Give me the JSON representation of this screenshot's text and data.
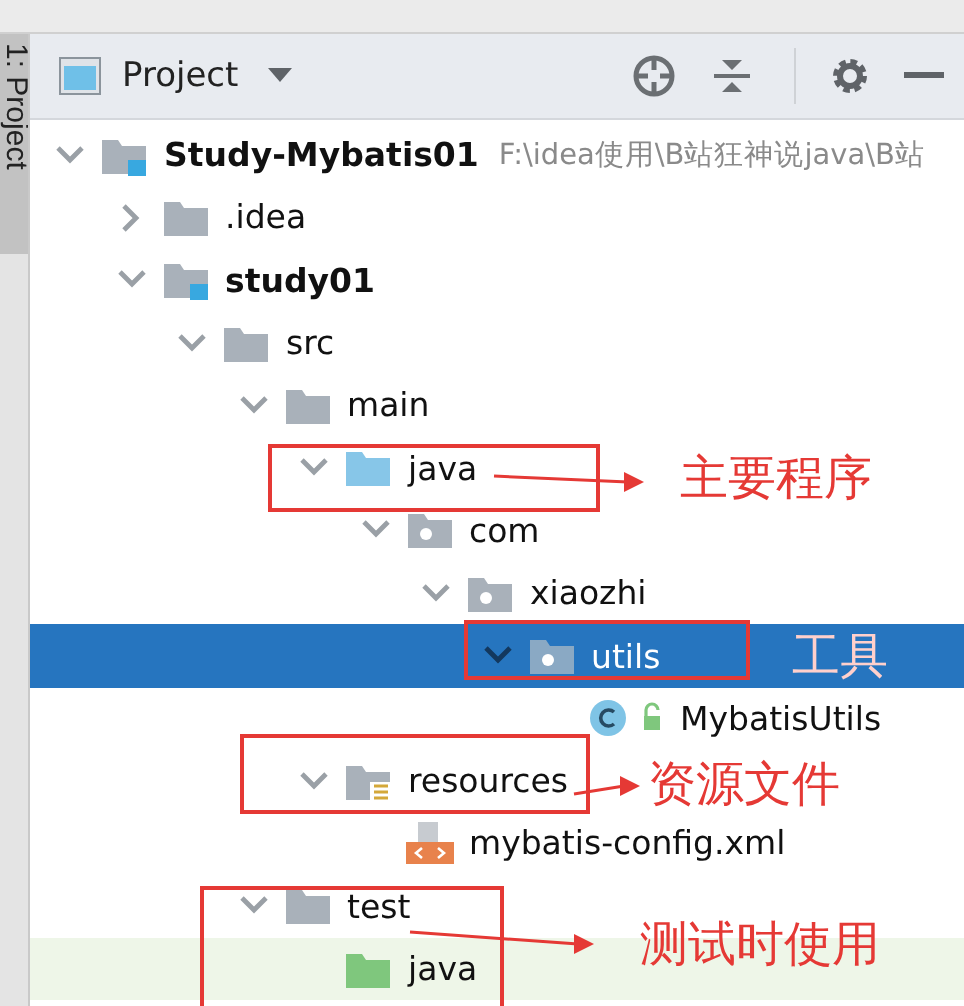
{
  "side_tab": {
    "label": "1: Project"
  },
  "panel": {
    "title": "Project"
  },
  "tree": [
    {
      "name": "Study-Mybatis01",
      "kind": "module",
      "path": "F:\\idea使用\\B站狂神说java\\B站",
      "expanded": true,
      "selected": false,
      "highlighted": false,
      "children": [
        {
          "name": ".idea",
          "kind": "folder",
          "expanded": false,
          "selected": false,
          "highlighted": false
        },
        {
          "name": "study01",
          "kind": "module",
          "expanded": true,
          "selected": false,
          "highlighted": false,
          "children": [
            {
              "name": "src",
              "kind": "folder",
              "expanded": true,
              "selected": false,
              "highlighted": false,
              "children": [
                {
                  "name": "main",
                  "kind": "folder",
                  "expanded": true,
                  "selected": false,
                  "highlighted": false,
                  "children": [
                    {
                      "name": "java",
                      "kind": "source",
                      "expanded": true,
                      "selected": false,
                      "highlighted": false,
                      "children": [
                        {
                          "name": "com",
                          "kind": "package",
                          "expanded": true,
                          "selected": false,
                          "highlighted": false,
                          "children": [
                            {
                              "name": "xiaozhi",
                              "kind": "package",
                              "expanded": true,
                              "selected": false,
                              "highlighted": false,
                              "children": [
                                {
                                  "name": "utils",
                                  "kind": "package",
                                  "expanded": true,
                                  "selected": true,
                                  "highlighted": false,
                                  "children": [
                                    {
                                      "name": "MybatisUtils",
                                      "kind": "class",
                                      "selected": false,
                                      "highlighted": false
                                    }
                                  ]
                                }
                              ]
                            }
                          ]
                        }
                      ]
                    },
                    {
                      "name": "resources",
                      "kind": "resources",
                      "expanded": true,
                      "selected": false,
                      "highlighted": false,
                      "children": [
                        {
                          "name": "mybatis-config.xml",
                          "kind": "xml",
                          "selected": false,
                          "highlighted": false
                        }
                      ]
                    }
                  ]
                },
                {
                  "name": "test",
                  "kind": "folder",
                  "expanded": true,
                  "selected": false,
                  "highlighted": false,
                  "children": [
                    {
                      "name": "java",
                      "kind": "test",
                      "selected": false,
                      "highlighted": true
                    }
                  ]
                }
              ]
            }
          ]
        }
      ]
    }
  ],
  "annotations": [
    {
      "text": "主要程序"
    },
    {
      "text": "工具"
    },
    {
      "text": "资源文件"
    },
    {
      "text": "测试时使用"
    }
  ]
}
